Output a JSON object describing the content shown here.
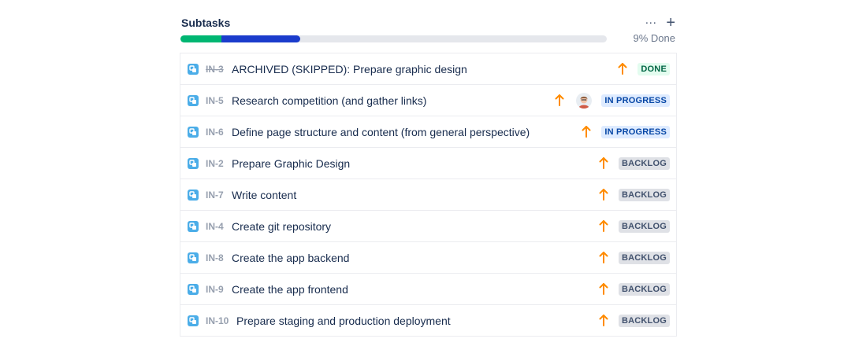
{
  "header": {
    "title": "Subtasks"
  },
  "progress": {
    "label": "9% Done",
    "done_fraction": 0.097,
    "in_progress_fraction": 0.185
  },
  "colors": {
    "done": "#00b672",
    "in_progress": "#1b3ccc",
    "priority": "#ff8b00"
  },
  "subtasks": [
    {
      "key": "IN-3",
      "summary": "ARCHIVED (SKIPPED): Prepare graphic design",
      "status": "DONE",
      "key_struck": true,
      "assignee": false,
      "priority_icon": "priority-high-icon"
    },
    {
      "key": "IN-5",
      "summary": "Research competition (and gather links)",
      "status": "IN PROGRESS",
      "key_struck": false,
      "assignee": true,
      "priority_icon": "priority-high-icon"
    },
    {
      "key": "IN-6",
      "summary": "Define page structure and content (from general perspective)",
      "status": "IN PROGRESS",
      "key_struck": false,
      "assignee": false,
      "priority_icon": "priority-high-icon"
    },
    {
      "key": "IN-2",
      "summary": "Prepare Graphic Design",
      "status": "BACKLOG",
      "key_struck": false,
      "assignee": false,
      "priority_icon": "priority-high-icon"
    },
    {
      "key": "IN-7",
      "summary": "Write content",
      "status": "BACKLOG",
      "key_struck": false,
      "assignee": false,
      "priority_icon": "priority-high-icon"
    },
    {
      "key": "IN-4",
      "summary": "Create git repository",
      "status": "BACKLOG",
      "key_struck": false,
      "assignee": false,
      "priority_icon": "priority-high-icon"
    },
    {
      "key": "IN-8",
      "summary": "Create the app backend",
      "status": "BACKLOG",
      "key_struck": false,
      "assignee": false,
      "priority_icon": "priority-high-icon"
    },
    {
      "key": "IN-9",
      "summary": "Create the app frontend",
      "status": "BACKLOG",
      "key_struck": false,
      "assignee": false,
      "priority_icon": "priority-high-icon"
    },
    {
      "key": "IN-10",
      "summary": "Prepare staging and production deployment",
      "status": "BACKLOG",
      "key_struck": false,
      "assignee": false,
      "priority_icon": "priority-high-icon"
    }
  ]
}
